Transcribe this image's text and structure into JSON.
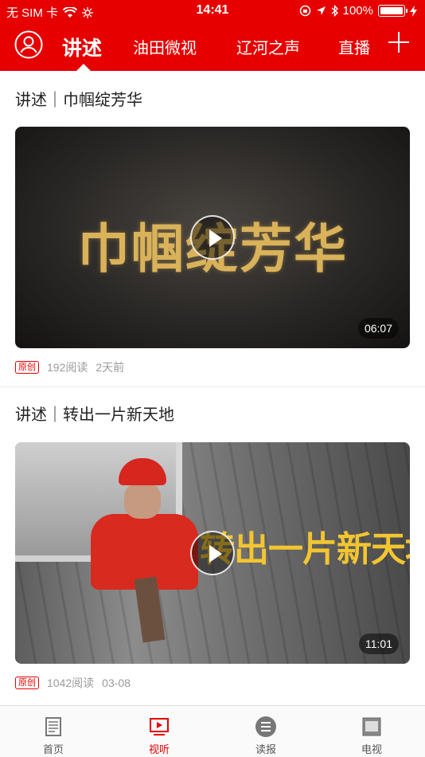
{
  "status_bar": {
    "carrier": "无 SIM 卡",
    "time": "14:41",
    "battery": "100%"
  },
  "nav": {
    "tabs": [
      {
        "label": "讲述",
        "active": true
      },
      {
        "label": "油田微视",
        "active": false
      },
      {
        "label": "辽河之声",
        "active": false
      },
      {
        "label": "直播",
        "active": false
      }
    ]
  },
  "feed": [
    {
      "title": "讲述｜巾帼绽芳华",
      "video_text": "巾帼绽芳华",
      "duration": "06:07",
      "badge": "原创",
      "reads": "192阅读",
      "time": "2天前"
    },
    {
      "title": "讲述｜转出一片新天地",
      "video_text": "转出一片新天地",
      "duration": "11:01",
      "badge": "原创",
      "reads": "1042阅读",
      "time": "03-08"
    }
  ],
  "tabbar": {
    "items": [
      {
        "label": "首页",
        "icon": "newspaper-icon"
      },
      {
        "label": "视听",
        "icon": "play-screen-icon",
        "active": true
      },
      {
        "label": "读报",
        "icon": "list-icon"
      },
      {
        "label": "电视",
        "icon": "tv-icon"
      }
    ]
  },
  "colors": {
    "accent": "#e60000"
  }
}
